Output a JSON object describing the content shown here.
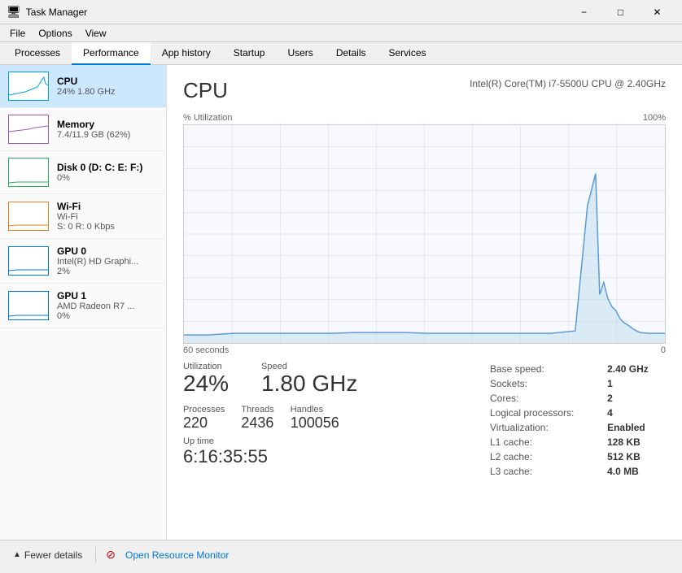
{
  "window": {
    "title": "Task Manager",
    "icon": "⊞"
  },
  "menu": {
    "items": [
      "File",
      "Options",
      "View"
    ]
  },
  "tabs": [
    {
      "label": "Processes",
      "active": false
    },
    {
      "label": "Performance",
      "active": true
    },
    {
      "label": "App history",
      "active": false
    },
    {
      "label": "Startup",
      "active": false
    },
    {
      "label": "Users",
      "active": false
    },
    {
      "label": "Details",
      "active": false
    },
    {
      "label": "Services",
      "active": false
    }
  ],
  "sidebar": {
    "items": [
      {
        "id": "cpu",
        "name": "CPU",
        "sub1": "24%  1.80 GHz",
        "type": "cpu",
        "active": true
      },
      {
        "id": "memory",
        "name": "Memory",
        "sub1": "7.4/11.9 GB (62%)",
        "type": "memory",
        "active": false
      },
      {
        "id": "disk0",
        "name": "Disk 0 (D: C: E: F:)",
        "sub1": "0%",
        "type": "disk",
        "active": false
      },
      {
        "id": "wifi",
        "name": "Wi-Fi",
        "sub1": "Wi-Fi",
        "sub2": "S: 0 R: 0 Kbps",
        "type": "wifi",
        "active": false
      },
      {
        "id": "gpu0",
        "name": "GPU 0",
        "sub1": "Intel(R) HD Graphi...",
        "sub2": "2%",
        "type": "gpu0",
        "active": false
      },
      {
        "id": "gpu1",
        "name": "GPU 1",
        "sub1": "AMD Radeon R7 ...",
        "sub2": "0%",
        "type": "gpu1",
        "active": false
      }
    ]
  },
  "detail": {
    "title": "CPU",
    "subtitle": "Intel(R) Core(TM) i7-5500U CPU @ 2.40GHz",
    "graph": {
      "y_label": "% Utilization",
      "y_max": "100%",
      "x_start": "60 seconds",
      "x_end": "0"
    },
    "stats": {
      "utilization_label": "Utilization",
      "utilization_value": "24%",
      "speed_label": "Speed",
      "speed_value": "1.80 GHz",
      "processes_label": "Processes",
      "processes_value": "220",
      "threads_label": "Threads",
      "threads_value": "2436",
      "handles_label": "Handles",
      "handles_value": "100056",
      "uptime_label": "Up time",
      "uptime_value": "6:16:35:55"
    },
    "info": {
      "base_speed_label": "Base speed:",
      "base_speed_value": "2.40 GHz",
      "sockets_label": "Sockets:",
      "sockets_value": "1",
      "cores_label": "Cores:",
      "cores_value": "2",
      "logical_processors_label": "Logical processors:",
      "logical_processors_value": "4",
      "virtualization_label": "Virtualization:",
      "virtualization_value": "Enabled",
      "l1_cache_label": "L1 cache:",
      "l1_cache_value": "128 KB",
      "l2_cache_label": "L2 cache:",
      "l2_cache_value": "512 KB",
      "l3_cache_label": "L3 cache:",
      "l3_cache_value": "4.0 MB"
    }
  },
  "bottom": {
    "fewer_details_label": "Fewer details",
    "open_resource_monitor_label": "Open Resource Monitor"
  }
}
